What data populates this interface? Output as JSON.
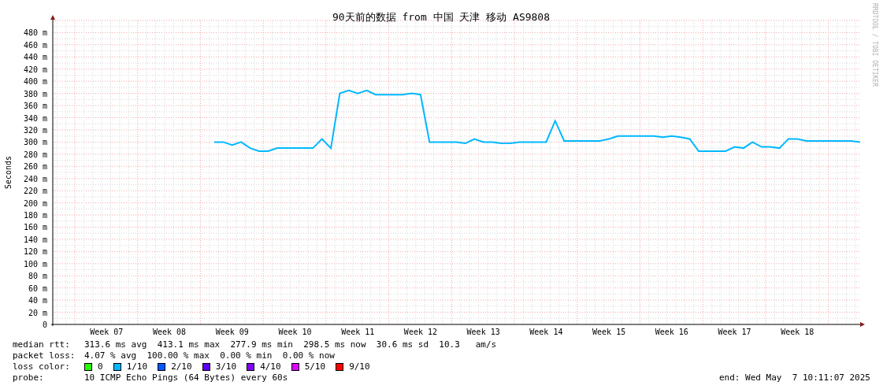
{
  "chart": {
    "chart_data": {
      "type": "line",
      "title": "90天前的数据 from 中国 天津 移动 AS9808",
      "ylabel": "Seconds",
      "ylim": [
        0,
        500
      ],
      "grid": true,
      "yticks": [
        {
          "value": 0,
          "label": "0"
        },
        {
          "value": 20,
          "label": "20 m"
        },
        {
          "value": 40,
          "label": "40 m"
        },
        {
          "value": 60,
          "label": "60 m"
        },
        {
          "value": 80,
          "label": "80 m"
        },
        {
          "value": 100,
          "label": "100 m"
        },
        {
          "value": 120,
          "label": "120 m"
        },
        {
          "value": 140,
          "label": "140 m"
        },
        {
          "value": 160,
          "label": "160 m"
        },
        {
          "value": 180,
          "label": "180 m"
        },
        {
          "value": 200,
          "label": "200 m"
        },
        {
          "value": 220,
          "label": "220 m"
        },
        {
          "value": 240,
          "label": "240 m"
        },
        {
          "value": 260,
          "label": "260 m"
        },
        {
          "value": 280,
          "label": "280 m"
        },
        {
          "value": 300,
          "label": "300 m"
        },
        {
          "value": 320,
          "label": "320 m"
        },
        {
          "value": 340,
          "label": "340 m"
        },
        {
          "value": 360,
          "label": "360 m"
        },
        {
          "value": 380,
          "label": "380 m"
        },
        {
          "value": 400,
          "label": "400 m"
        },
        {
          "value": 420,
          "label": "420 m"
        },
        {
          "value": 440,
          "label": "440 m"
        },
        {
          "value": 460,
          "label": "460 m"
        },
        {
          "value": 480,
          "label": "480 m"
        }
      ],
      "categories": [
        null,
        null,
        null,
        null,
        null,
        null,
        "Week 07",
        null,
        null,
        null,
        null,
        null,
        null,
        "Week 08",
        null,
        null,
        null,
        null,
        null,
        null,
        "Week 09",
        null,
        null,
        null,
        null,
        null,
        null,
        "Week 10",
        null,
        null,
        null,
        null,
        null,
        null,
        "Week 11",
        null,
        null,
        null,
        null,
        null,
        null,
        "Week 12",
        null,
        null,
        null,
        null,
        null,
        null,
        "Week 13",
        null,
        null,
        null,
        null,
        null,
        null,
        "Week 14",
        null,
        null,
        null,
        null,
        null,
        null,
        "Week 15",
        null,
        null,
        null,
        null,
        null,
        null,
        "Week 16",
        null,
        null,
        null,
        null,
        null,
        null,
        "Week 17",
        null,
        null,
        null,
        null,
        null,
        null,
        "Week 18",
        null,
        null,
        null,
        null,
        null,
        null,
        null
      ],
      "series": [
        {
          "color": "#00b8ff",
          "values": [
            null,
            null,
            null,
            null,
            null,
            null,
            null,
            null,
            null,
            null,
            null,
            null,
            null,
            null,
            null,
            null,
            null,
            null,
            300,
            300,
            295,
            300,
            290,
            285,
            285,
            290,
            290,
            290,
            290,
            290,
            305,
            290,
            380,
            385,
            380,
            385,
            378,
            378,
            378,
            378,
            380,
            378,
            300,
            300,
            300,
            300,
            298,
            305,
            300,
            300,
            298,
            298,
            300,
            300,
            300,
            300,
            335,
            302,
            302,
            302,
            302,
            302,
            305,
            310,
            310,
            310,
            310,
            310,
            308,
            310,
            308,
            305,
            285,
            285,
            285,
            285,
            292,
            290,
            300,
            292,
            292,
            290,
            305,
            305,
            302,
            302,
            302,
            302,
            302,
            302,
            300
          ]
        }
      ]
    }
  },
  "legend": {
    "stats": [
      {
        "label": "median rtt:",
        "value": "313.6 ms avg  413.1 ms max  277.9 ms min  298.5 ms now  30.6 ms sd  10.3   am/s"
      },
      {
        "label": "packet loss:",
        "value": "4.07 % avg  100.00 % max  0.00 % min  0.00 % now"
      }
    ],
    "loss_color": {
      "label": "loss color:",
      "items": [
        {
          "label": "0",
          "color": "#26ff00"
        },
        {
          "label": "1/10",
          "color": "#00b8ff"
        },
        {
          "label": "2/10",
          "color": "#0059ff"
        },
        {
          "label": "3/10",
          "color": "#5e00ff"
        },
        {
          "label": "4/10",
          "color": "#7e00ff"
        },
        {
          "label": "5/10",
          "color": "#dd00ff"
        },
        {
          "label": "9/10",
          "color": "#ff0000"
        }
      ]
    },
    "probe": {
      "label": "probe:",
      "value": "10 ICMP Echo Pings (64 Bytes) every 60s"
    },
    "end": "end: Wed May  7 10:11:07 2025"
  },
  "watermark_side": "RRDTOOL / TOBI OETIKER"
}
